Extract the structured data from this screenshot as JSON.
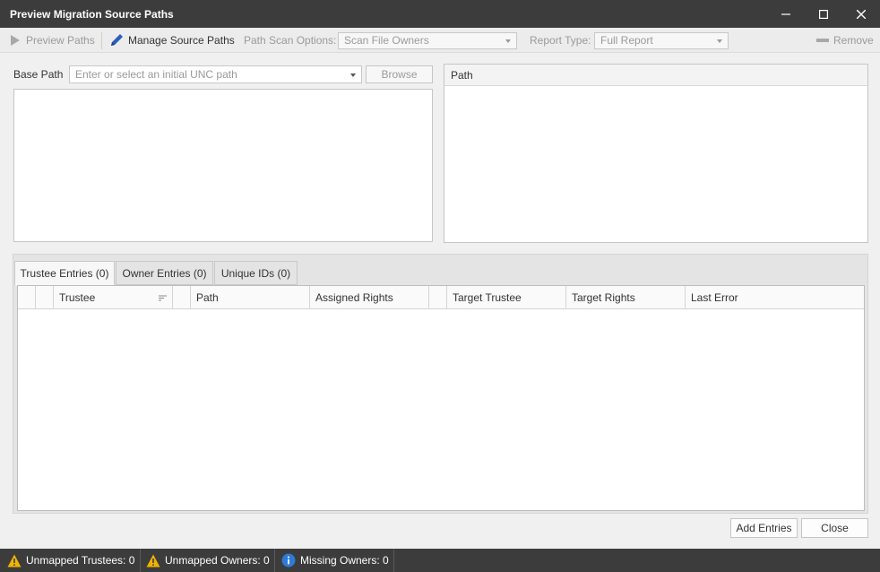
{
  "window": {
    "title": "Preview Migration Source Paths",
    "controls": [
      "minimize-icon",
      "maximize-icon",
      "close-icon"
    ]
  },
  "toolbar": {
    "preview_paths": "Preview Paths",
    "manage_source_paths": "Manage Source Paths",
    "path_scan_label": "Path Scan Options:",
    "path_scan_value": "Scan File Owners",
    "report_type_label": "Report Type:",
    "report_type_value": "Full Report",
    "remove": "Remove"
  },
  "base_path": {
    "label": "Base Path",
    "placeholder": "Enter or select an initial UNC path",
    "browse": "Browse"
  },
  "path_panel": {
    "header": "Path"
  },
  "tabs": [
    {
      "label": "Trustee Entries (0)",
      "active": true
    },
    {
      "label": "Owner Entries (0)",
      "active": false
    },
    {
      "label": "Unique IDs (0)",
      "active": false
    }
  ],
  "grid": {
    "columns": [
      "",
      "",
      "Trustee",
      "",
      "Path",
      "Assigned Rights",
      "",
      "Target Trustee",
      "Target Rights",
      "Last Error"
    ]
  },
  "buttons": {
    "add_entries": "Add Entries",
    "close": "Close"
  },
  "status": {
    "unmapped_trustees": "Unmapped Trustees: 0",
    "unmapped_owners": "Unmapped Owners: 0",
    "missing_owners": "Missing Owners: 0"
  },
  "colors": {
    "titlebar": "#3c3c3c",
    "warning": "#f0b400",
    "info": "#2f7ad6",
    "accent_pencil": "#2b5fb8"
  }
}
